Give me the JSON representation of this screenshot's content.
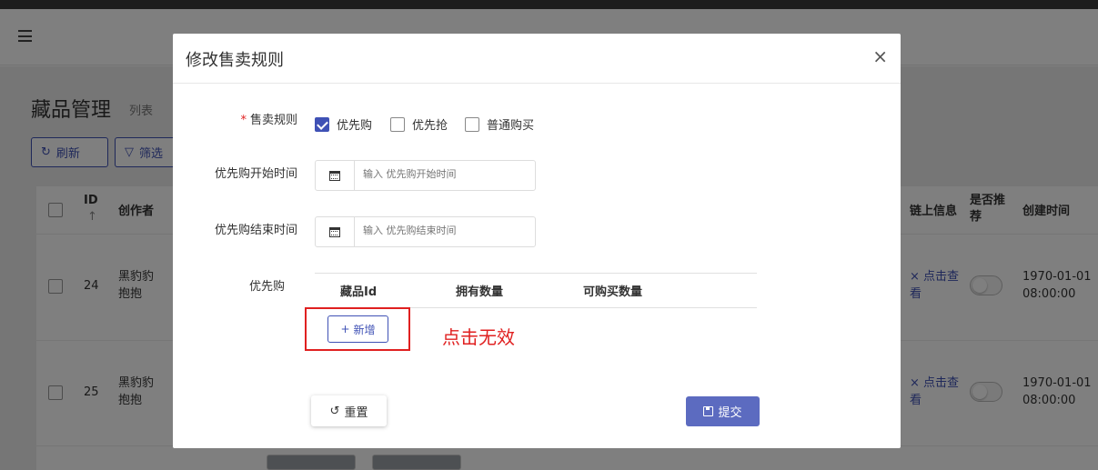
{
  "background": {
    "page_title": "藏品管理",
    "page_subtitle": "列表",
    "refresh_label": "刷新",
    "filter_label": "筛选",
    "columns": [
      "ID",
      "创作者",
      "链上信息",
      "是否推荐",
      "创建时间"
    ],
    "rows": [
      {
        "id": "24",
        "creator": "黑豹豹抱抱",
        "chain_info": "× 点击查看",
        "created": "1970-01-01 08:00:00"
      },
      {
        "id": "25",
        "creator": "黑豹豹抱抱",
        "chain_info": "× 点击查看",
        "created": "1970-01-01 08:00:00"
      }
    ]
  },
  "modal": {
    "title": "修改售卖规则",
    "close_icon": "×",
    "sale_rule": {
      "label": "售卖规则",
      "required_mark": "*",
      "options": [
        {
          "label": "优先购",
          "checked": true
        },
        {
          "label": "优先抢",
          "checked": false
        },
        {
          "label": "普通购买",
          "checked": false
        }
      ]
    },
    "start_time": {
      "label": "优先购开始时间",
      "placeholder": "输入 优先购开始时间"
    },
    "end_time": {
      "label": "优先购结束时间",
      "placeholder": "输入 优先购结束时间"
    },
    "priority": {
      "label": "优先购",
      "columns": [
        "藏品Id",
        "拥有数量",
        "可购买数量"
      ],
      "add_label": "新增"
    },
    "annotation": "点击无效",
    "reset_label": "重置",
    "submit_label": "提交"
  },
  "colors": {
    "primary": "#3f51b5",
    "submit": "#5c6bc0",
    "annotation_red": "#e02020"
  }
}
